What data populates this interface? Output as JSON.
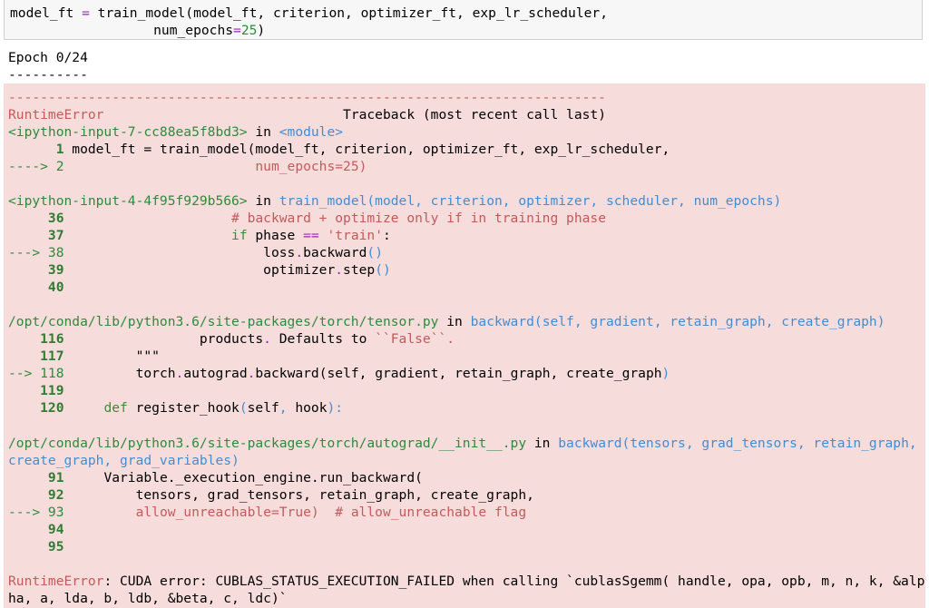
{
  "code_cell": {
    "line1_prefix": "model_ft ",
    "line1_eq": "=",
    "line1_rest": " train_model(model_ft, criterion, optimizer_ft, exp_lr_scheduler,",
    "line2_indent": "                  num_epochs",
    "line2_eq": "=",
    "line2_num": "25",
    "line2_end": ")"
  },
  "stdout": {
    "line1": "Epoch 0/24",
    "line2": "----------"
  },
  "traceback": {
    "dash_line": "---------------------------------------------------------------------------",
    "error_name": "RuntimeError",
    "header_spacing": "                              ",
    "header_title": "Traceback (most recent call last)",
    "frame1": {
      "location": "<ipython-input-7-cc88ea5f8bd3>",
      "in_word": " in ",
      "func": "<module>",
      "l1_num": "      1",
      "l1_code": " model_ft = train_model(model_ft, criterion, optimizer_ft, exp_lr_scheduler,",
      "l2_arrow": "----> 2",
      "l2_code": "                        num_epochs=25)"
    },
    "frame2": {
      "location": "<ipython-input-4-4f95f929b566>",
      "in_word": " in ",
      "func": "train_model(model, criterion, optimizer, scheduler, num_epochs)",
      "l36_num": "     36",
      "l36_code": "                     # backward + optimize only if in training phase",
      "l37_num": "     37",
      "l37_indent": "                     ",
      "l37_kw": "if",
      "l37_mid": " phase ",
      "l37_op": "==",
      "l37_str": " 'train'",
      "l37_end": ":",
      "l38_arrow": "---> 38",
      "l38_indent": "                         loss",
      "l38_dot": ".",
      "l38_call": "backward",
      "l38_paren": "()",
      "l39_num": "     39",
      "l39_indent": "                         optimizer",
      "l39_dot": ".",
      "l39_call": "step",
      "l39_paren": "()",
      "l40_num": "     40"
    },
    "frame3": {
      "location": "/opt/conda/lib/python3.6/site-packages/torch/tensor.py",
      "in_word": " in ",
      "func": "backward(self, gradient, retain_graph, create_graph)",
      "l116_num": "    116",
      "l116_text": "                 products",
      "l116_dot": ".",
      "l116_rest": " Defaults to ",
      "l116_str": "``False``.",
      "l117_num": "    117",
      "l117_text": "         \"\"\"",
      "l118_arrow": "--> 118",
      "l118_text": "         torch",
      "l118_d1": ".",
      "l118_m1": "autograd",
      "l118_d2": ".",
      "l118_m2": "backward(self, gradient, retain_graph, create_graph",
      "l118_close": ")",
      "l119_num": "    119",
      "l120_num": "    120",
      "l120_indent": "     ",
      "l120_kw": "def",
      "l120_name": " register_hook",
      "l120_p1": "(",
      "l120_self": "self",
      "l120_comma": ",",
      "l120_hook": " hook",
      "l120_end": "):"
    },
    "frame4": {
      "location": "/opt/conda/lib/python3.6/site-packages/torch/autograd/__init__.py",
      "in_word": " in ",
      "func_line1": "backward(tensors, grad_tensors, retain_graph,",
      "func_line2": "create_graph, grad_variables)",
      "l91_num": "     91",
      "l91_text": "     Variable._execution_engine.run_backward(",
      "l92_num": "     92",
      "l92_text": "         tensors, grad_tensors, retain_graph, create_graph,",
      "l93_arrow": "---> 93",
      "l93_text": "         allow_unreachable=True)  # allow_unreachable flag",
      "l94_num": "     94",
      "l95_num": "     95"
    },
    "final_error_name": "RuntimeError",
    "final_message_line1": ": CUDA error: CUBLAS_STATUS_EXECUTION_FAILED when calling `cublasSgemm( handle, opa, opb, m, n, k, &alp",
    "final_message_line2": "ha, a, lda, b, ldb, &beta, c, ldc)`"
  }
}
